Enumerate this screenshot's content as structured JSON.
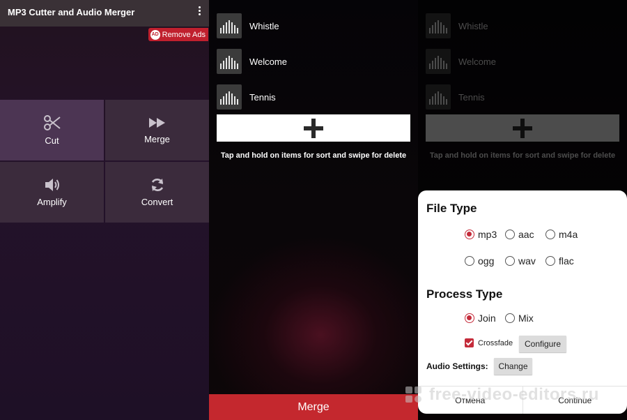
{
  "screen1": {
    "app_title": "MP3 Cutter and Audio Merger",
    "remove_ads": {
      "badge": "AD",
      "label": "Remove Ads"
    },
    "tiles": [
      {
        "label": "Cut",
        "icon": "scissors-icon"
      },
      {
        "label": "Merge",
        "icon": "fast-forward-icon"
      },
      {
        "label": "Amplify",
        "icon": "speaker-icon"
      },
      {
        "label": "Convert",
        "icon": "refresh-icon"
      }
    ]
  },
  "screen2": {
    "tracks": [
      {
        "name": "Whistle"
      },
      {
        "name": "Welcome"
      },
      {
        "name": "Tennis"
      }
    ],
    "add_icon": "plus-icon",
    "hint": "Tap and hold on items for sort and swipe for delete",
    "merge_label": "Merge"
  },
  "screen3": {
    "tracks": [
      {
        "name": "Whistle"
      },
      {
        "name": "Welcome"
      },
      {
        "name": "Tennis"
      }
    ],
    "hint": "Tap and hold on items for sort and swipe for delete",
    "dialog": {
      "file_type_title": "File Type",
      "file_types": [
        {
          "label": "mp3",
          "selected": true
        },
        {
          "label": "aac",
          "selected": false
        },
        {
          "label": "m4a",
          "selected": false
        },
        {
          "label": "ogg",
          "selected": false
        },
        {
          "label": "wav",
          "selected": false
        },
        {
          "label": "flac",
          "selected": false
        }
      ],
      "process_type_title": "Process Type",
      "process_types": [
        {
          "label": "Join",
          "selected": true
        },
        {
          "label": "Mix",
          "selected": false
        }
      ],
      "crossfade_label": "Crossfade",
      "crossfade_checked": true,
      "configure_label": "Configure",
      "audio_settings_label": "Audio Settings:",
      "change_label": "Change",
      "cancel_label": "Отмена",
      "continue_label": "Continue"
    }
  },
  "watermark": {
    "text": "free-video-editors.ru"
  },
  "colors": {
    "accent": "#c4282e",
    "radio_accent": "#c42b3a",
    "tile": "#3b2b3c",
    "appbar": "#3a3136"
  }
}
